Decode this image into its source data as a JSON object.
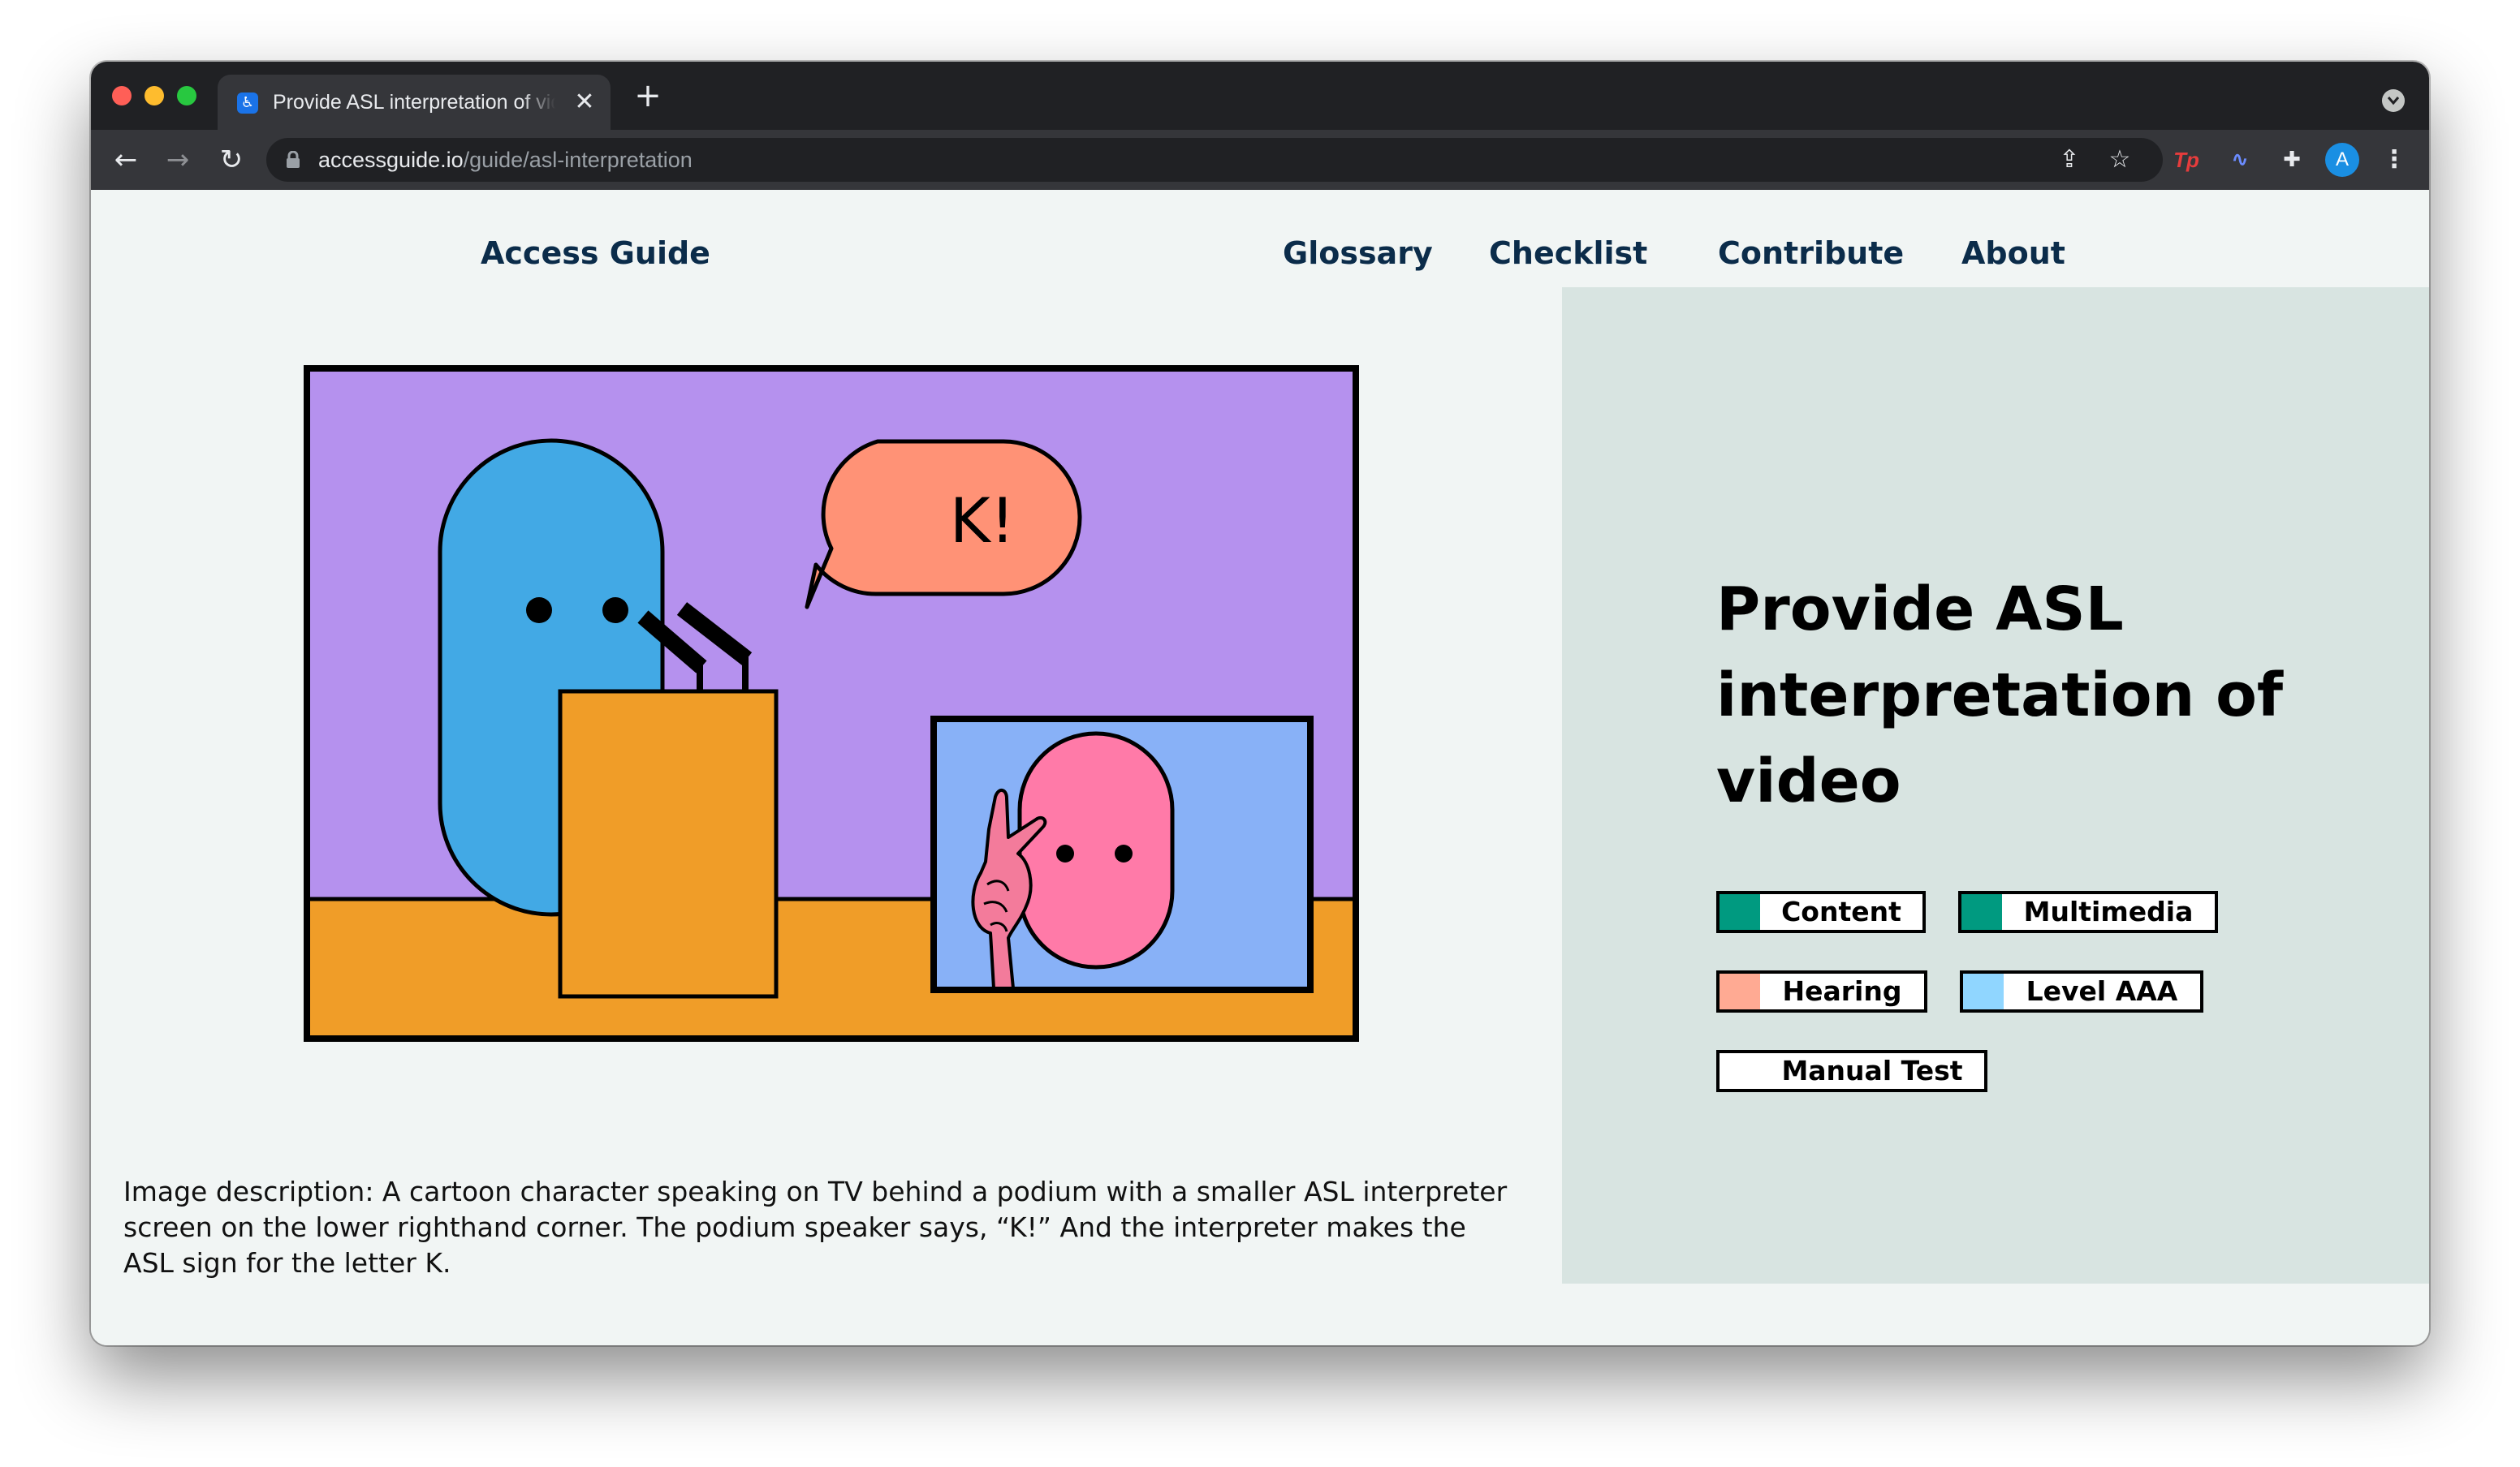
{
  "browser": {
    "tab_title": "Provide ASL interpretation of video",
    "tab_favicon": "accessibility-icon",
    "close_glyph": "✕",
    "new_tab_glyph": "+",
    "back_glyph": "←",
    "forward_glyph": "→",
    "reload_glyph": "↻",
    "url_host": "accessguide.io",
    "url_path": "/guide/asl-interpretation",
    "share_glyph": "⇪",
    "bookmark_glyph": "☆",
    "extension_tp_label": "Tp",
    "extension_wave_glyph": "∿",
    "extension_puzzle_glyph": "✚",
    "profile_initial": "A",
    "menu_glyph": "⋮"
  },
  "site": {
    "logo": "Access Guide",
    "nav": [
      "Glossary",
      "Checklist",
      "Contribute",
      "About"
    ]
  },
  "illustration": {
    "speech_text": "K!",
    "colors": {
      "background": "#b591ee",
      "floor": "#f09d28",
      "speaker": "#42a9e5",
      "bubble": "#ff9276",
      "inset_background": "#88b1f7",
      "interpreter": "#ff7aa8",
      "hand": "#f37b9b"
    }
  },
  "image_description": "Image description: A cartoon character speaking on TV behind a podium with a smaller ASL interpreter screen on the lower righthand corner. The podium speaker says, “K!” And the interpreter makes the ASL sign for the letter K.",
  "guide": {
    "title": "Provide ASL interpretation of video",
    "tags": [
      {
        "label": "Content",
        "color": "#009a80"
      },
      {
        "label": "Multimedia",
        "color": "#009a80"
      },
      {
        "label": "Hearing",
        "color": "#ffaa93"
      },
      {
        "label": "Level AAA",
        "color": "#90d6ff"
      },
      {
        "label": "Manual Test",
        "color": "#ffffff"
      }
    ]
  }
}
